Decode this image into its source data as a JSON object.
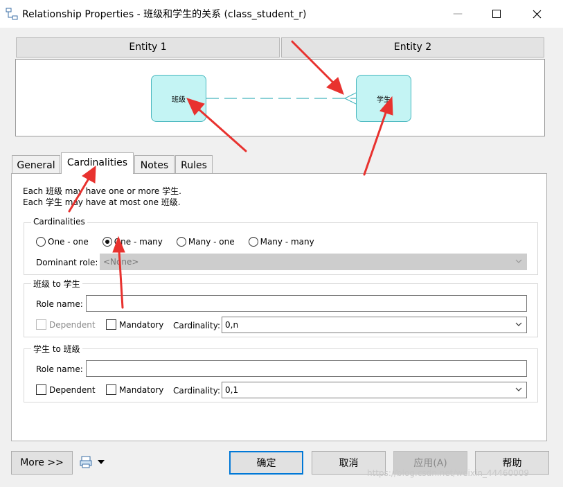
{
  "window": {
    "title": "Relationship Properties - 班级和学生的关系 (class_student_r)",
    "controls": {
      "minimize": "—",
      "maximize": "☐",
      "close": "✕"
    }
  },
  "entities": {
    "entity1_header": "Entity 1",
    "entity2_header": "Entity 2",
    "entity1_name": "班级",
    "entity2_name": "学生"
  },
  "tabs": [
    "General",
    "Cardinalities",
    "Notes",
    "Rules"
  ],
  "active_tab": "Cardinalities",
  "description": {
    "line1": "Each 班级 may have one or more 学生.",
    "line2": "Each 学生 may have at most one 班级."
  },
  "cardinalities_group": {
    "title": "Cardinalities",
    "options": [
      "One - one",
      "One - many",
      "Many - one",
      "Many - many"
    ],
    "selected": "One - many",
    "dominant_role_label": "Dominant role:",
    "dominant_role_value": "<None>"
  },
  "role_a": {
    "title": "班级 to 学生",
    "role_name_label": "Role name:",
    "role_name_value": "",
    "dependent_label": "Dependent",
    "dependent_enabled": false,
    "mandatory_label": "Mandatory",
    "cardinality_label": "Cardinality:",
    "cardinality_value": "0,n"
  },
  "role_b": {
    "title": "学生 to 班级",
    "role_name_label": "Role name:",
    "role_name_value": "",
    "dependent_label": "Dependent",
    "dependent_enabled": true,
    "mandatory_label": "Mandatory",
    "cardinality_label": "Cardinality:",
    "cardinality_value": "0,1"
  },
  "buttons": {
    "more": "More >>",
    "ok": "确定",
    "cancel": "取消",
    "apply": "应用(A)",
    "help": "帮助"
  },
  "watermark": "https://blog.csdn.net/weixin_44460009",
  "colors": {
    "entity_fill": "#c4f4f4",
    "entity_border": "#45b5bd",
    "annotation_arrow": "#e8322f",
    "focus_border": "#0078d7"
  }
}
